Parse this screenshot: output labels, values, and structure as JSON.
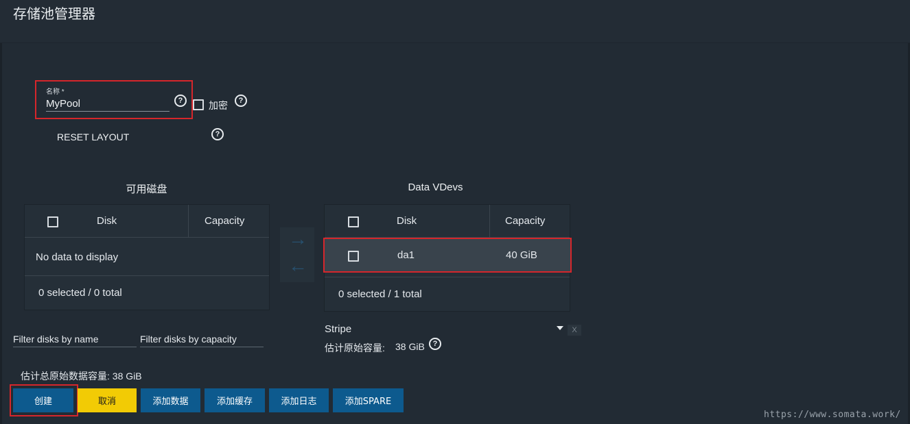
{
  "header": {
    "title": "存储池管理器"
  },
  "form": {
    "name_label": "名称 *",
    "name_value": "MyPool",
    "encrypt_label": "加密",
    "reset_layout_label": "RESET LAYOUT"
  },
  "available": {
    "title": "可用磁盘",
    "columns": [
      "Disk",
      "Capacity"
    ],
    "empty_text": "No data to display",
    "footer": "0 selected / 0 total"
  },
  "vdevs": {
    "title": "Data VDevs",
    "columns": [
      "Disk",
      "Capacity"
    ],
    "rows": [
      {
        "disk": "da1",
        "capacity": "40 GiB"
      }
    ],
    "footer": "0 selected / 1 total",
    "layout_type": "Stripe",
    "remove_label": "X",
    "estimated_raw_label": "估计原始容量:",
    "estimated_raw_value": "38 GiB"
  },
  "filters": {
    "name_placeholder": "Filter disks by name",
    "capacity_placeholder": "Filter disks by capacity"
  },
  "summary": {
    "total_raw_text": "估计总原始数据容量: 38 GiB"
  },
  "buttons": {
    "create": "创建",
    "cancel": "取消",
    "add_data": "添加数据",
    "add_cache": "添加缓存",
    "add_log": "添加日志",
    "add_spare": "添加SPARE"
  },
  "icons": {
    "help": "help-icon",
    "arrow_right": "arrow-right-icon",
    "arrow_left": "arrow-left-icon",
    "caret": "chevron-down-icon"
  },
  "colors": {
    "background": "#222b34",
    "primary": "#0d5a8e",
    "warning": "#f2cb05",
    "highlight": "#d6262b"
  },
  "watermark": "https://www.somata.work/"
}
